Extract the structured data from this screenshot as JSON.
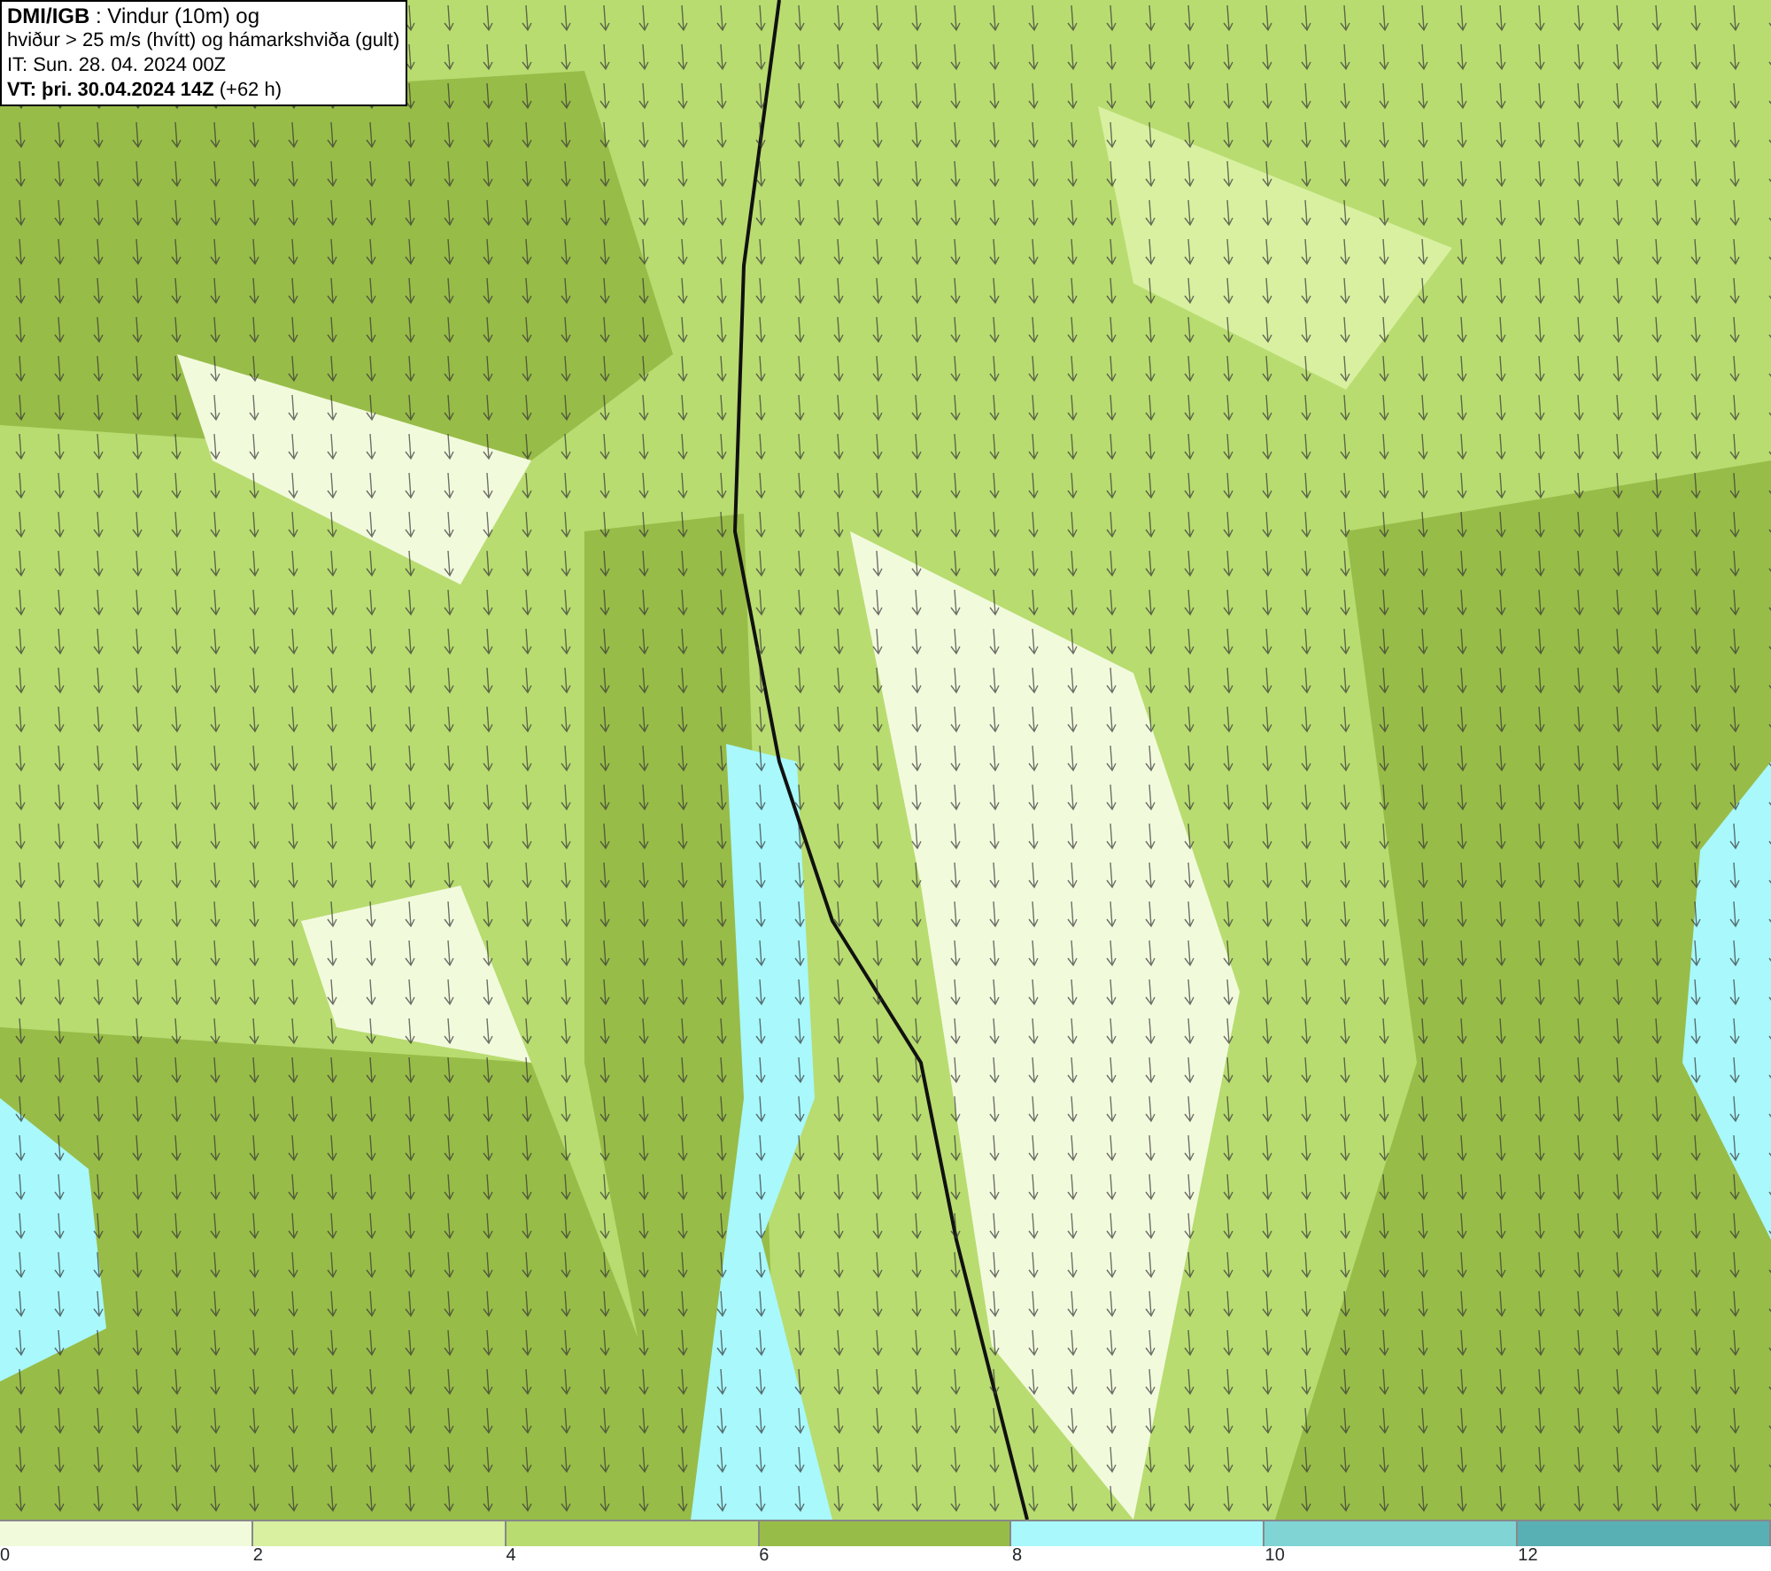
{
  "info_box": {
    "lines": [
      "**DMI/IGB** : Vindur (10m) og",
      "hviður > 25 m/s (hvítt) og hámarkshviða (gult)",
      "IT: Sun. 28. 04. 2024 00Z",
      "**VT: þri. 30.04.2024 14Z** (+62 h)"
    ]
  },
  "legend": {
    "bins": [
      {
        "color": "#f2fadc"
      },
      {
        "color": "#d8f0a0"
      },
      {
        "color": "#b8dc70"
      },
      {
        "color": "#98bc48"
      },
      {
        "color": "#a8f8fc"
      },
      {
        "color": "#80d4d4"
      },
      {
        "color": "#58b0b4"
      }
    ],
    "ticks": [
      "0",
      "2",
      "4",
      "6",
      "8",
      "10",
      "12"
    ]
  }
}
